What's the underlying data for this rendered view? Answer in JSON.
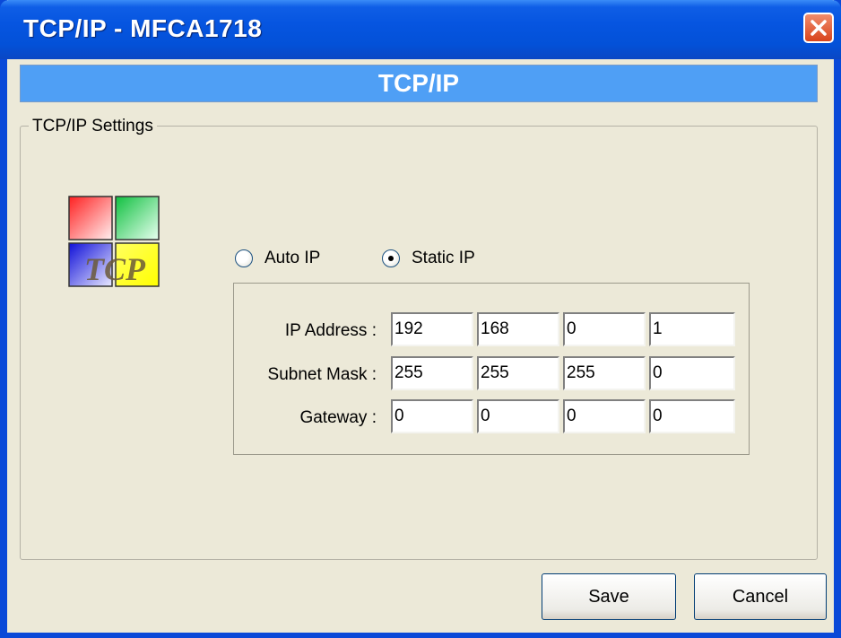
{
  "window": {
    "title": "TCP/IP - MFCA1718"
  },
  "banner": {
    "title": "TCP/IP"
  },
  "group": {
    "label": "TCP/IP Settings"
  },
  "logo": {
    "text": "TCP"
  },
  "mode": {
    "auto_label": "Auto IP",
    "static_label": "Static IP",
    "selected": "static"
  },
  "fields": {
    "ip_label": "IP Address :",
    "ip": [
      "192",
      "168",
      "0",
      "1"
    ],
    "mask_label": "Subnet Mask :",
    "mask": [
      "255",
      "255",
      "255",
      "0"
    ],
    "gateway_label": "Gateway :",
    "gateway": [
      "0",
      "0",
      "0",
      "0"
    ]
  },
  "buttons": {
    "save": "Save",
    "cancel": "Cancel"
  },
  "colors": {
    "titlebar": "#0655e0",
    "banner": "#4f9ff5",
    "window_bg": "#ece9d8",
    "close": "#d8441c"
  }
}
